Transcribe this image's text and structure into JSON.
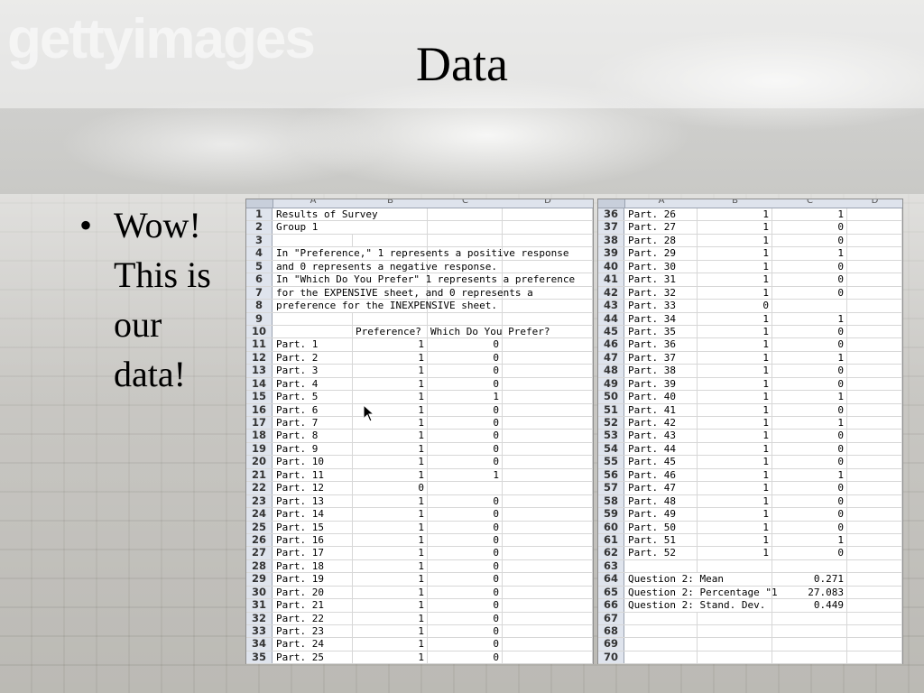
{
  "slide": {
    "title": "Data",
    "watermark": "gettyimages",
    "bullets": [
      "Wow! This is our data!"
    ]
  },
  "spreadsheet": {
    "columns": [
      "A",
      "B",
      "C",
      "D"
    ],
    "left_panel": [
      {
        "row": "1",
        "a": "Results of Survey",
        "b": "",
        "c": "",
        "span": true
      },
      {
        "row": "2",
        "a": "Group 1",
        "b": "",
        "c": "",
        "span": true
      },
      {
        "row": "3",
        "a": "",
        "b": "",
        "c": ""
      },
      {
        "row": "4",
        "a": "In \"Preference,\" 1 represents a positive response",
        "b": "",
        "c": "",
        "span": true
      },
      {
        "row": "5",
        "a": "and 0 represents a negative response.",
        "b": "",
        "c": "",
        "span": true
      },
      {
        "row": "6",
        "a": "In \"Which Do You Prefer\" 1 represents a preference",
        "b": "",
        "c": "",
        "span": true
      },
      {
        "row": "7",
        "a": "for the EXPENSIVE sheet, and 0 represents a",
        "b": "",
        "c": "",
        "span": true
      },
      {
        "row": "8",
        "a": "preference for the INEXPENSIVE sheet.",
        "b": "",
        "c": "",
        "span": true
      },
      {
        "row": "9",
        "a": "",
        "b": "",
        "c": ""
      },
      {
        "row": "10",
        "a": "",
        "b": "Preference?",
        "c": "Which Do You Prefer?",
        "header": true
      },
      {
        "row": "11",
        "a": "Part. 1",
        "b": "1",
        "c": "0"
      },
      {
        "row": "12",
        "a": "Part. 2",
        "b": "1",
        "c": "0"
      },
      {
        "row": "13",
        "a": "Part. 3",
        "b": "1",
        "c": "0"
      },
      {
        "row": "14",
        "a": "Part. 4",
        "b": "1",
        "c": "0"
      },
      {
        "row": "15",
        "a": "Part. 5",
        "b": "1",
        "c": "1"
      },
      {
        "row": "16",
        "a": "Part. 6",
        "b": "1",
        "c": "0"
      },
      {
        "row": "17",
        "a": "Part. 7",
        "b": "1",
        "c": "0"
      },
      {
        "row": "18",
        "a": "Part. 8",
        "b": "1",
        "c": "0"
      },
      {
        "row": "19",
        "a": "Part. 9",
        "b": "1",
        "c": "0"
      },
      {
        "row": "20",
        "a": "Part. 10",
        "b": "1",
        "c": "0"
      },
      {
        "row": "21",
        "a": "Part. 11",
        "b": "1",
        "c": "1"
      },
      {
        "row": "22",
        "a": "Part. 12",
        "b": "0",
        "c": ""
      },
      {
        "row": "23",
        "a": "Part. 13",
        "b": "1",
        "c": "0"
      },
      {
        "row": "24",
        "a": "Part. 14",
        "b": "1",
        "c": "0"
      },
      {
        "row": "25",
        "a": "Part. 15",
        "b": "1",
        "c": "0"
      },
      {
        "row": "26",
        "a": "Part. 16",
        "b": "1",
        "c": "0"
      },
      {
        "row": "27",
        "a": "Part. 17",
        "b": "1",
        "c": "0"
      },
      {
        "row": "28",
        "a": "Part. 18",
        "b": "1",
        "c": "0"
      },
      {
        "row": "29",
        "a": "Part. 19",
        "b": "1",
        "c": "0"
      },
      {
        "row": "30",
        "a": "Part. 20",
        "b": "1",
        "c": "0"
      },
      {
        "row": "31",
        "a": "Part. 21",
        "b": "1",
        "c": "0"
      },
      {
        "row": "32",
        "a": "Part. 22",
        "b": "1",
        "c": "0"
      },
      {
        "row": "33",
        "a": "Part. 23",
        "b": "1",
        "c": "0"
      },
      {
        "row": "34",
        "a": "Part. 24",
        "b": "1",
        "c": "0"
      },
      {
        "row": "35",
        "a": "Part. 25",
        "b": "1",
        "c": "0"
      }
    ],
    "right_panel": [
      {
        "row": "36",
        "a": "Part. 26",
        "b": "1",
        "c": "1"
      },
      {
        "row": "37",
        "a": "Part. 27",
        "b": "1",
        "c": "0"
      },
      {
        "row": "38",
        "a": "Part. 28",
        "b": "1",
        "c": "0"
      },
      {
        "row": "39",
        "a": "Part. 29",
        "b": "1",
        "c": "1"
      },
      {
        "row": "40",
        "a": "Part. 30",
        "b": "1",
        "c": "0"
      },
      {
        "row": "41",
        "a": "Part. 31",
        "b": "1",
        "c": "0"
      },
      {
        "row": "42",
        "a": "Part. 32",
        "b": "1",
        "c": "0"
      },
      {
        "row": "43",
        "a": "Part. 33",
        "b": "0",
        "c": ""
      },
      {
        "row": "44",
        "a": "Part. 34",
        "b": "1",
        "c": "1"
      },
      {
        "row": "45",
        "a": "Part. 35",
        "b": "1",
        "c": "0"
      },
      {
        "row": "46",
        "a": "Part. 36",
        "b": "1",
        "c": "0"
      },
      {
        "row": "47",
        "a": "Part. 37",
        "b": "1",
        "c": "1"
      },
      {
        "row": "48",
        "a": "Part. 38",
        "b": "1",
        "c": "0"
      },
      {
        "row": "49",
        "a": "Part. 39",
        "b": "1",
        "c": "0"
      },
      {
        "row": "50",
        "a": "Part. 40",
        "b": "1",
        "c": "1"
      },
      {
        "row": "51",
        "a": "Part. 41",
        "b": "1",
        "c": "0"
      },
      {
        "row": "52",
        "a": "Part. 42",
        "b": "1",
        "c": "1"
      },
      {
        "row": "53",
        "a": "Part. 43",
        "b": "1",
        "c": "0"
      },
      {
        "row": "54",
        "a": "Part. 44",
        "b": "1",
        "c": "0"
      },
      {
        "row": "55",
        "a": "Part. 45",
        "b": "1",
        "c": "0"
      },
      {
        "row": "56",
        "a": "Part. 46",
        "b": "1",
        "c": "1"
      },
      {
        "row": "57",
        "a": "Part. 47",
        "b": "1",
        "c": "0"
      },
      {
        "row": "58",
        "a": "Part. 48",
        "b": "1",
        "c": "0"
      },
      {
        "row": "59",
        "a": "Part. 49",
        "b": "1",
        "c": "0"
      },
      {
        "row": "60",
        "a": "Part. 50",
        "b": "1",
        "c": "0"
      },
      {
        "row": "61",
        "a": "Part. 51",
        "b": "1",
        "c": "1"
      },
      {
        "row": "62",
        "a": "Part. 52",
        "b": "1",
        "c": "0"
      },
      {
        "row": "63",
        "a": "",
        "b": "",
        "c": ""
      },
      {
        "row": "64",
        "a": "Question 2: Mean",
        "b": "",
        "c": "0.271",
        "span": true
      },
      {
        "row": "65",
        "a": "Question 2: Percentage \"1",
        "b": "",
        "c": "27.083",
        "span": true
      },
      {
        "row": "66",
        "a": "Question 2: Stand. Dev.",
        "b": "",
        "c": "0.449",
        "span": true
      },
      {
        "row": "67",
        "a": "",
        "b": "",
        "c": ""
      },
      {
        "row": "68",
        "a": "",
        "b": "",
        "c": ""
      },
      {
        "row": "69",
        "a": "",
        "b": "",
        "c": ""
      },
      {
        "row": "70",
        "a": "",
        "b": "",
        "c": ""
      }
    ]
  },
  "icons": {
    "cursor": "arrow-cursor-icon",
    "bullet": "bullet-dot-icon"
  }
}
